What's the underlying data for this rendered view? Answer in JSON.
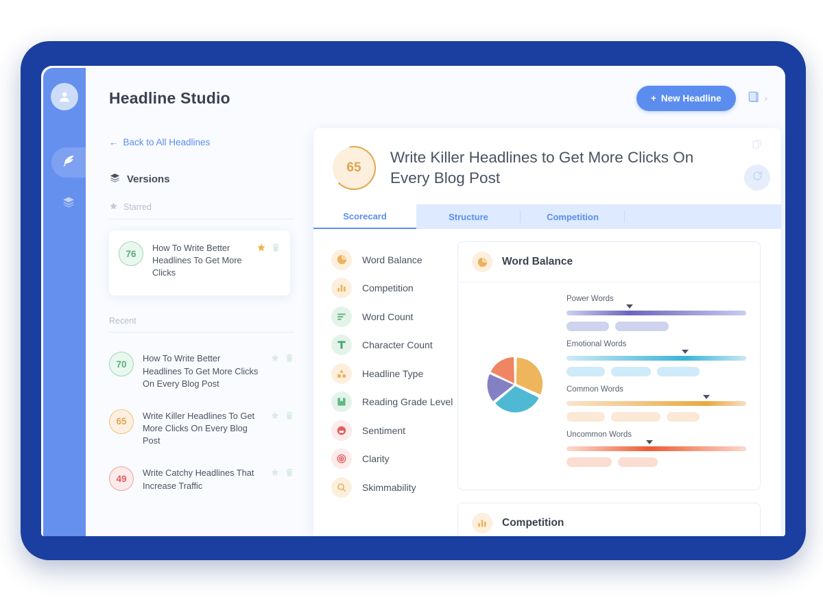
{
  "app": {
    "title": "Headline Studio",
    "new_headline_label": "New Headline",
    "new_headline_plus": "+",
    "header_chevron": "›"
  },
  "rail": {
    "items": [
      {
        "icon": "user-avatar-icon",
        "active": false
      },
      {
        "icon": "feather-pen-icon",
        "active": true
      },
      {
        "icon": "layers-stack-icon",
        "active": false
      }
    ]
  },
  "versions": {
    "back_link": "Back to All Headlines",
    "back_arrow": "←",
    "section_title": "Versions",
    "starred_label": "Starred",
    "recent_label": "Recent",
    "starred": [
      {
        "score": "76",
        "tone": "green",
        "text": "How To Write Better Headlines To Get More Clicks",
        "starred": true
      }
    ],
    "recent": [
      {
        "score": "70",
        "tone": "green",
        "text": "How To Write Better Headlines To Get More Clicks On Every Blog Post",
        "starred": false
      },
      {
        "score": "65",
        "tone": "orange",
        "text": "Write Killer Headlines To Get More Clicks On Every Blog Post",
        "starred": false
      },
      {
        "score": "49",
        "tone": "red",
        "text": "Write Catchy Headlines That Increase Traffic",
        "starred": false
      }
    ]
  },
  "detail": {
    "score": "65",
    "score_percent": 65,
    "headline": "Write Killer Headlines to Get More Clicks On Every Blog Post",
    "tabs": [
      {
        "label": "Scorecard",
        "active": true
      },
      {
        "label": "Structure",
        "active": false
      },
      {
        "label": "Competition",
        "active": false
      }
    ],
    "metrics": [
      {
        "label": "Word Balance",
        "icon": "pie-chart-icon",
        "tone": "orange"
      },
      {
        "label": "Competition",
        "icon": "bar-chart-icon",
        "tone": "orange"
      },
      {
        "label": "Word Count",
        "icon": "text-lines-icon",
        "tone": "green"
      },
      {
        "label": "Character Count",
        "icon": "letter-t-icon",
        "tone": "green"
      },
      {
        "label": "Headline Type",
        "icon": "shapes-icon",
        "tone": "orange"
      },
      {
        "label": "Reading Grade Level",
        "icon": "book-icon",
        "tone": "green"
      },
      {
        "label": "Sentiment",
        "icon": "sentiment-face-icon",
        "tone": "red"
      },
      {
        "label": "Clarity",
        "icon": "target-icon",
        "tone": "red"
      },
      {
        "label": "Skimmability",
        "icon": "magnifier-icon",
        "tone": "orange"
      }
    ],
    "panels": [
      {
        "title": "Word Balance",
        "icon": "pie-chart-icon"
      },
      {
        "title": "Competition",
        "icon": "bar-chart-icon"
      }
    ]
  },
  "chart_data": {
    "type": "pie",
    "title": "Word Balance",
    "labels": [
      "Common Words",
      "Emotional Words",
      "Power Words",
      "Uncommon Words"
    ],
    "values": [
      32,
      32,
      18,
      18
    ],
    "colors": [
      "#eeb55c",
      "#4fb9d4",
      "#8480c4",
      "#ef8563"
    ],
    "legend": "none",
    "bars": [
      {
        "label": "Power Words",
        "marker_percent": 35,
        "chips": 2,
        "gradient": [
          "#cdd2f0",
          "#6b64bd",
          "#c8cdee"
        ],
        "chip_color": "#ced3ef"
      },
      {
        "label": "Emotional Words",
        "marker_percent": 66,
        "chips": 3,
        "gradient": [
          "#cfe9f7",
          "#39b4d8",
          "#cbe7f6"
        ],
        "chip_color": "#cfeaf8"
      },
      {
        "label": "Common Words",
        "marker_percent": 78,
        "chips": 3,
        "gradient": [
          "#fbe3cd",
          "#e8a93f",
          "#fbdcc4"
        ],
        "chip_color": "#fbe8d7"
      },
      {
        "label": "Uncommon Words",
        "marker_percent": 46,
        "chips": 2,
        "gradient": [
          "#fbdcd0",
          "#ee5b33",
          "#fbd9cc"
        ],
        "chip_color": "#fbddd1"
      }
    ]
  },
  "colors": {
    "accent": "#5b8def",
    "frame": "#1b3fa0",
    "rail": "#6690ee",
    "green": "#5aaf7c",
    "orange": "#e0a44f",
    "red": "#e06060"
  }
}
